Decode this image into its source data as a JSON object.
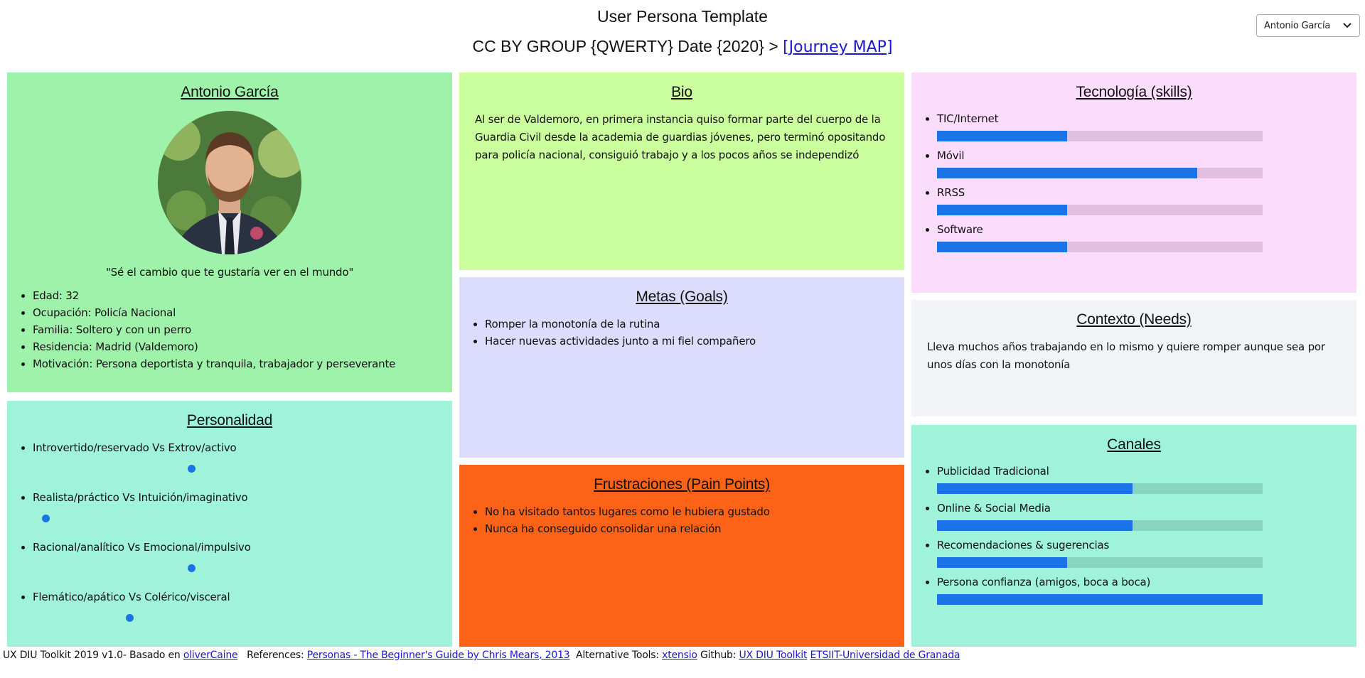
{
  "header": {
    "title": "User Persona Template",
    "subtitle": "CC BY GROUP {QWERTY} Date {2020} >",
    "journey_link": "[Journey MAP]",
    "persona_select": "Antonio García"
  },
  "profile": {
    "name": "Antonio García",
    "quote": "\"Sé el cambio que te gustaría ver en el mundo\"",
    "details": [
      "Edad: 32",
      "Ocupación: Policía Nacional",
      "Familia: Soltero y con un perro",
      "Residencia: Madrid (Valdemoro)",
      "Motivación: Persona deportista y tranquila, trabajador y perseverante"
    ]
  },
  "personality": {
    "title": "Personalidad",
    "traits": [
      {
        "label": "Introvertido/reservado Vs Extrov/activo",
        "value": 0.5
      },
      {
        "label": "Realista/práctico Vs Intuición/imaginativo",
        "value": 0.03
      },
      {
        "label": "Racional/analítico Vs Emocional/impulsivo",
        "value": 0.5
      },
      {
        "label": "Flemático/apático Vs Colérico/visceral",
        "value": 0.3
      }
    ]
  },
  "bio": {
    "title": "Bio",
    "text": "Al ser de Valdemoro, en primera instancia quiso formar parte del cuerpo de la Guardia Civil desde la academia de guardias jóvenes, pero terminó opositando para policía nacional, consiguió trabajo y a los pocos años se independizó"
  },
  "goals": {
    "title": "Metas (Goals)",
    "items": [
      "Romper la monotonía de la rutina",
      "Hacer nuevas actividades junto a mi fiel compañero"
    ]
  },
  "frustrations": {
    "title": "Frustraciones (Pain Points)",
    "items": [
      "No ha visitado tantos lugares como le hubiera gustado",
      "Nunca ha conseguido consolidar una relación"
    ]
  },
  "technology": {
    "title": "Tecnología (skills)",
    "skills": [
      {
        "label": "TIC/Internet",
        "level": 0.4
      },
      {
        "label": "Móvil",
        "level": 0.8
      },
      {
        "label": "RRSS",
        "level": 0.4
      },
      {
        "label": "Software",
        "level": 0.4
      }
    ]
  },
  "context": {
    "title": "Contexto (Needs)",
    "text": "Lleva muchos años trabajando en lo mismo y quiere romper aunque sea por unos días con la monotonía"
  },
  "channels": {
    "title": "Canales",
    "items": [
      {
        "label": "Publicidad Tradicional",
        "level": 0.6
      },
      {
        "label": "Online & Social Media",
        "level": 0.6
      },
      {
        "label": "Recomendaciones & sugerencias",
        "level": 0.4
      },
      {
        "label": "Persona confianza (amigos, boca a boca)",
        "level": 1.0
      }
    ]
  },
  "footer": {
    "prefix": "UX DIU Toolkit 2019 v1.0- Basado en",
    "link1": "oliverCaine",
    "refs_label": "References:",
    "link2": "Personas - The Beginner's Guide by Chris Mears, 2013",
    "alt_label": "Alternative Tools:",
    "link3": "xtensio",
    "github_label": "Github:",
    "link4": "UX DIU Toolkit",
    "link5": "ETSIIT-Universidad de Granada"
  },
  "colors": {
    "accent": "#1b73e8",
    "link": "#1a1acc"
  }
}
